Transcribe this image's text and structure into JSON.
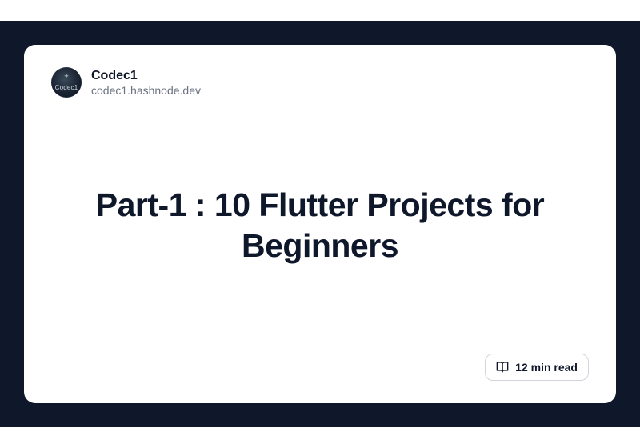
{
  "author": {
    "name": "Codec1",
    "domain": "codec1.hashnode.dev",
    "avatar_text": "Codec1"
  },
  "post": {
    "title": "Part-1 : 10 Flutter Projects for Beginners",
    "read_time": "12 min read"
  }
}
